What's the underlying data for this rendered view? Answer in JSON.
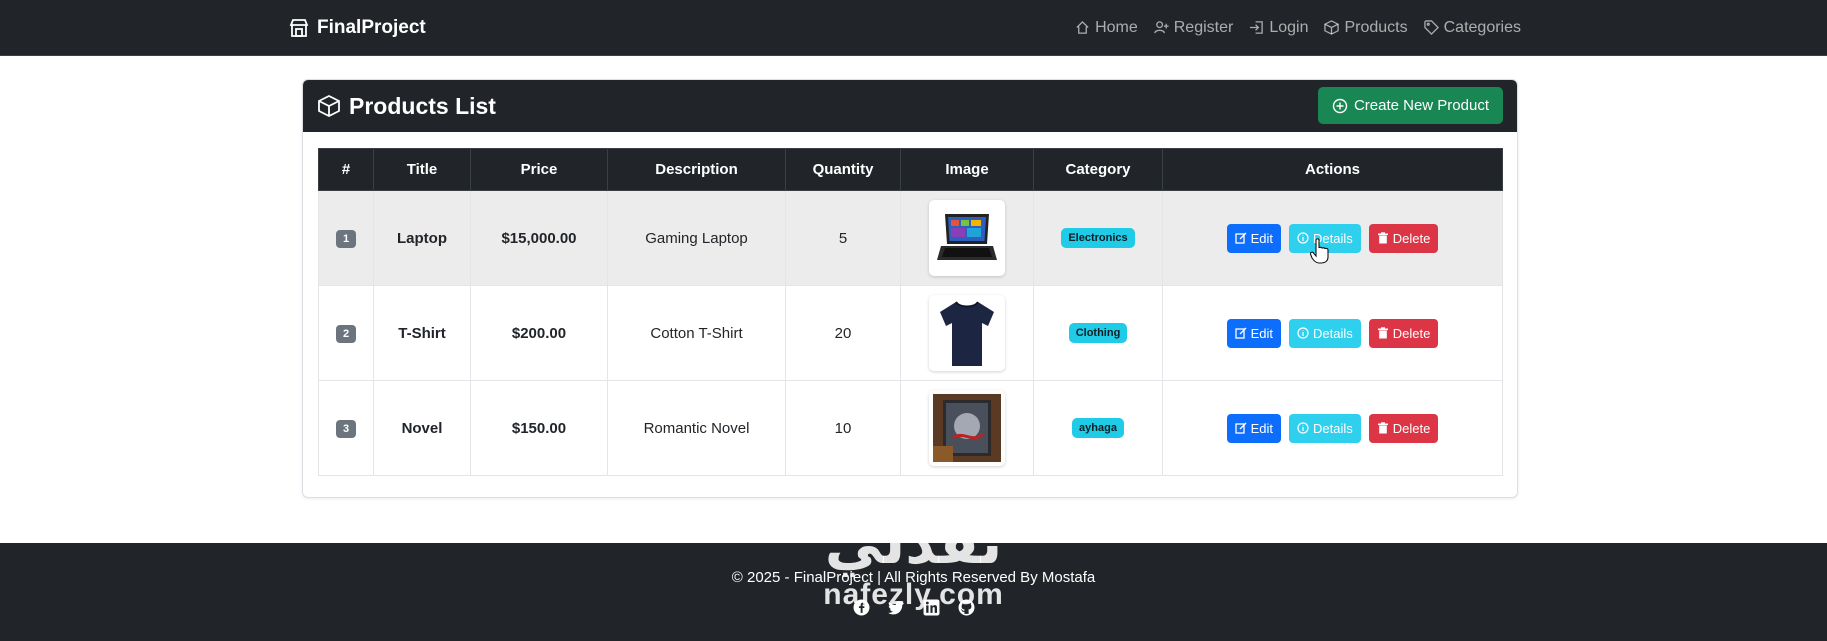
{
  "navbar": {
    "brand": "FinalProject",
    "links": [
      {
        "label": "Home",
        "icon": "house-icon"
      },
      {
        "label": "Register",
        "icon": "user-plus-icon"
      },
      {
        "label": "Login",
        "icon": "login-icon"
      },
      {
        "label": "Products",
        "icon": "box-icon"
      },
      {
        "label": "Categories",
        "icon": "tag-icon"
      }
    ]
  },
  "card": {
    "title": "Products List",
    "create_button": "Create New Product"
  },
  "table": {
    "columns": [
      "#",
      "Title",
      "Price",
      "Description",
      "Quantity",
      "Image",
      "Category",
      "Actions"
    ],
    "rows": [
      {
        "index": "1",
        "title": "Laptop",
        "price": "$15,000.00",
        "description": "Gaming Laptop",
        "quantity": "5",
        "image": "laptop",
        "category": "Electronics"
      },
      {
        "index": "2",
        "title": "T-Shirt",
        "price": "$200.00",
        "description": "Cotton T-Shirt",
        "quantity": "20",
        "image": "tshirt",
        "category": "Clothing"
      },
      {
        "index": "3",
        "title": "Novel",
        "price": "$150.00",
        "description": "Romantic Novel",
        "quantity": "10",
        "image": "book",
        "category": "ayhaga"
      }
    ],
    "actions": {
      "edit": "Edit",
      "details": "Details",
      "delete": "Delete"
    }
  },
  "footer": {
    "copyright": "© 2025 - FinalProject | All Rights Reserved By Mostafa",
    "socials": [
      "facebook-icon",
      "twitter-icon",
      "linkedin-icon",
      "github-icon"
    ]
  },
  "watermark": {
    "arabic": "نفذلي",
    "latin": "nafezly.com"
  },
  "colors": {
    "dark": "#212529",
    "success": "#198754",
    "primary": "#0d6efd",
    "info": "#2fd0ee",
    "danger": "#dc3545",
    "badge_secondary": "#6c757d"
  }
}
